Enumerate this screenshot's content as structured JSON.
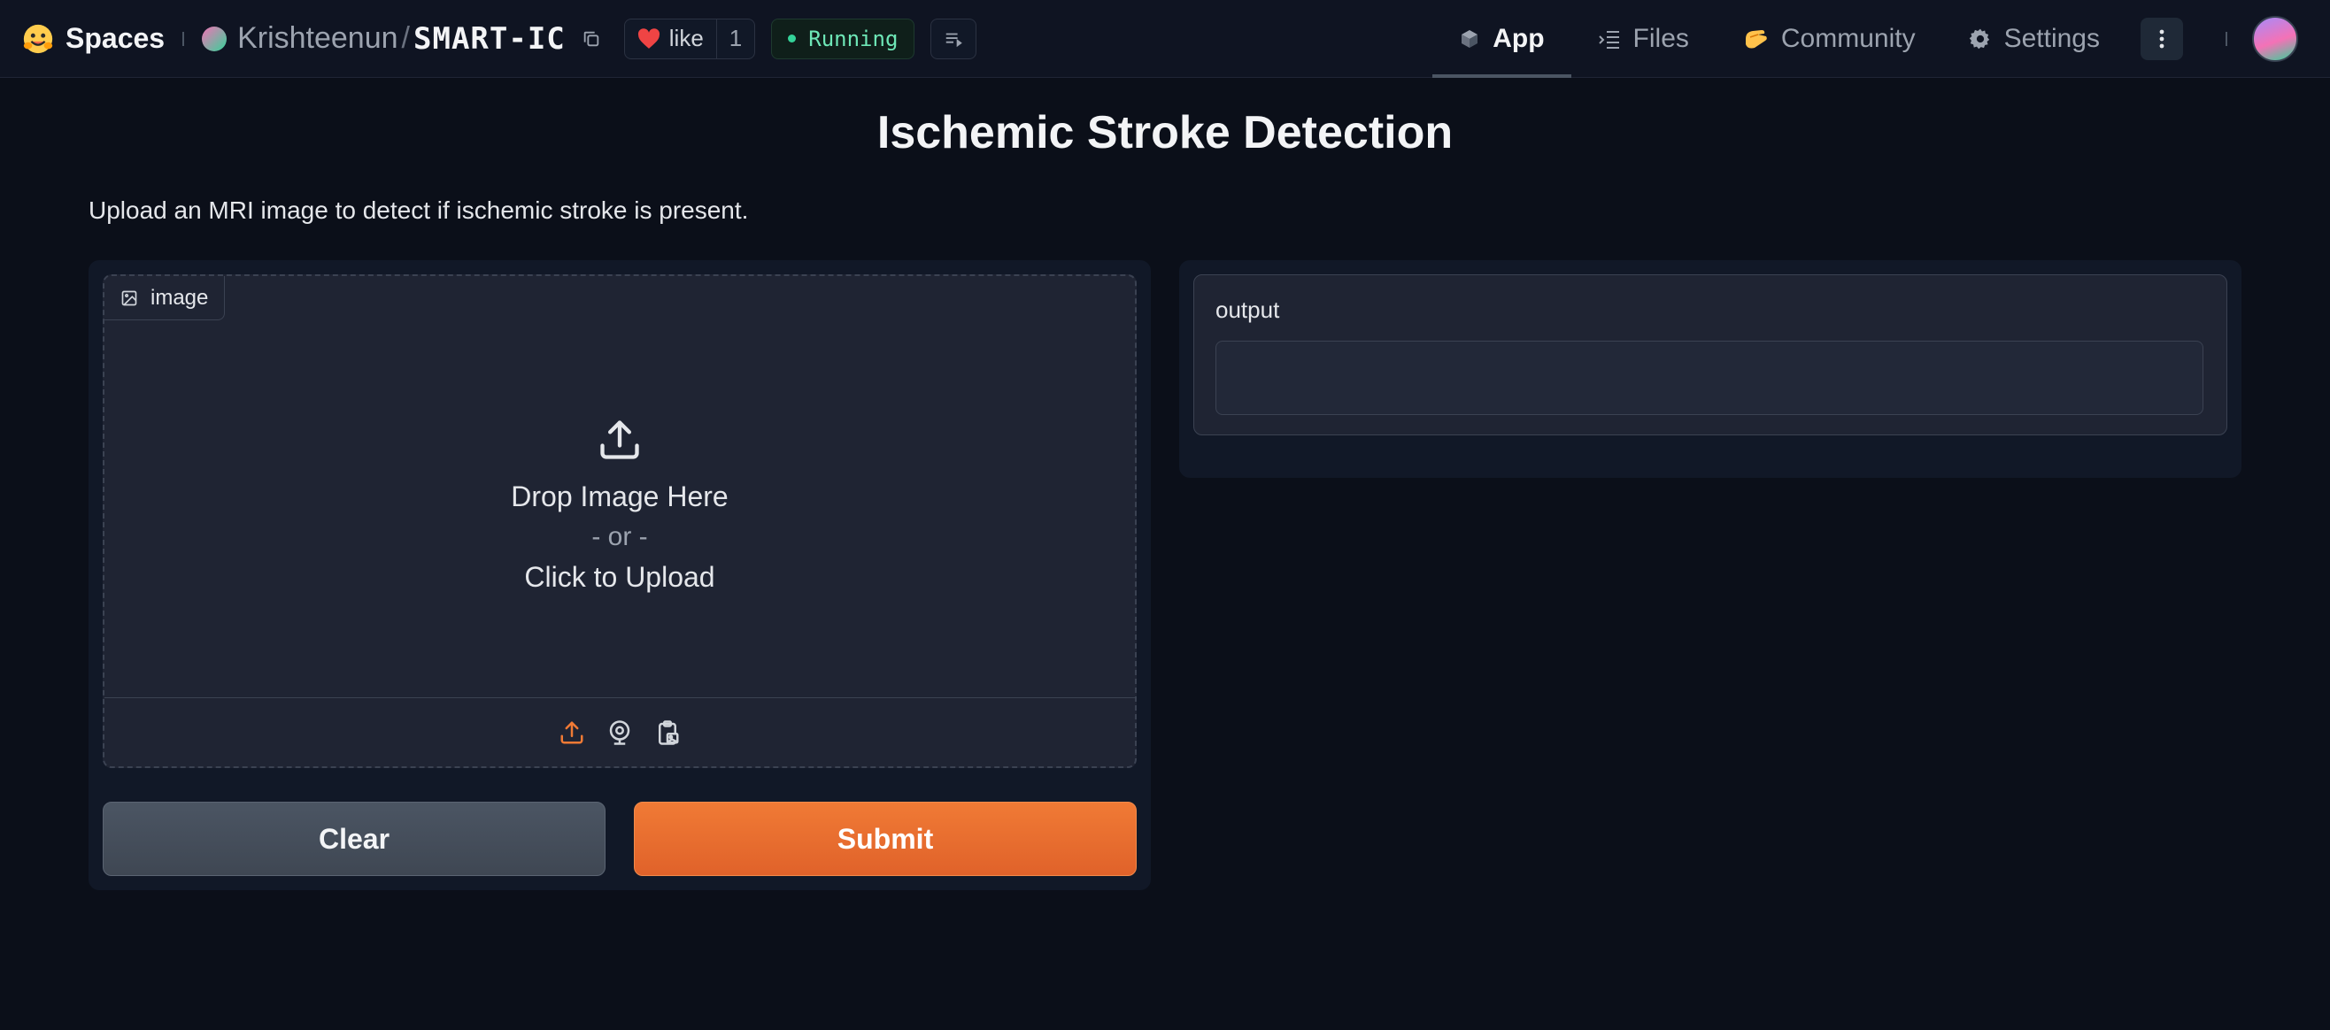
{
  "header": {
    "brand": "Spaces",
    "owner": "Krishteenun",
    "separator": "/",
    "repo": "SMART-IC",
    "like_label": "like",
    "like_count": "1",
    "status": "Running",
    "nav": {
      "app": "App",
      "files": "Files",
      "community": "Community",
      "settings": "Settings"
    }
  },
  "main": {
    "title": "Ischemic Stroke Detection",
    "description": "Upload an MRI image to detect if ischemic stroke is present.",
    "image_input": {
      "label": "image",
      "drop_text": "Drop Image Here",
      "or_text": "- or -",
      "click_text": "Click to Upload"
    },
    "buttons": {
      "clear": "Clear",
      "submit": "Submit"
    },
    "output": {
      "label": "output",
      "value": ""
    }
  },
  "colors": {
    "background": "#0b0f19",
    "panel": "#111827",
    "accent": "#f07a35",
    "status_green": "#34d399"
  },
  "icons": [
    "hugging-face-logo",
    "copy-icon",
    "heart-icon",
    "logs-icon",
    "cube-icon",
    "files-icon",
    "community-icon",
    "gear-icon",
    "more-vertical-icon",
    "image-icon",
    "upload-icon",
    "webcam-icon",
    "clipboard-icon"
  ]
}
